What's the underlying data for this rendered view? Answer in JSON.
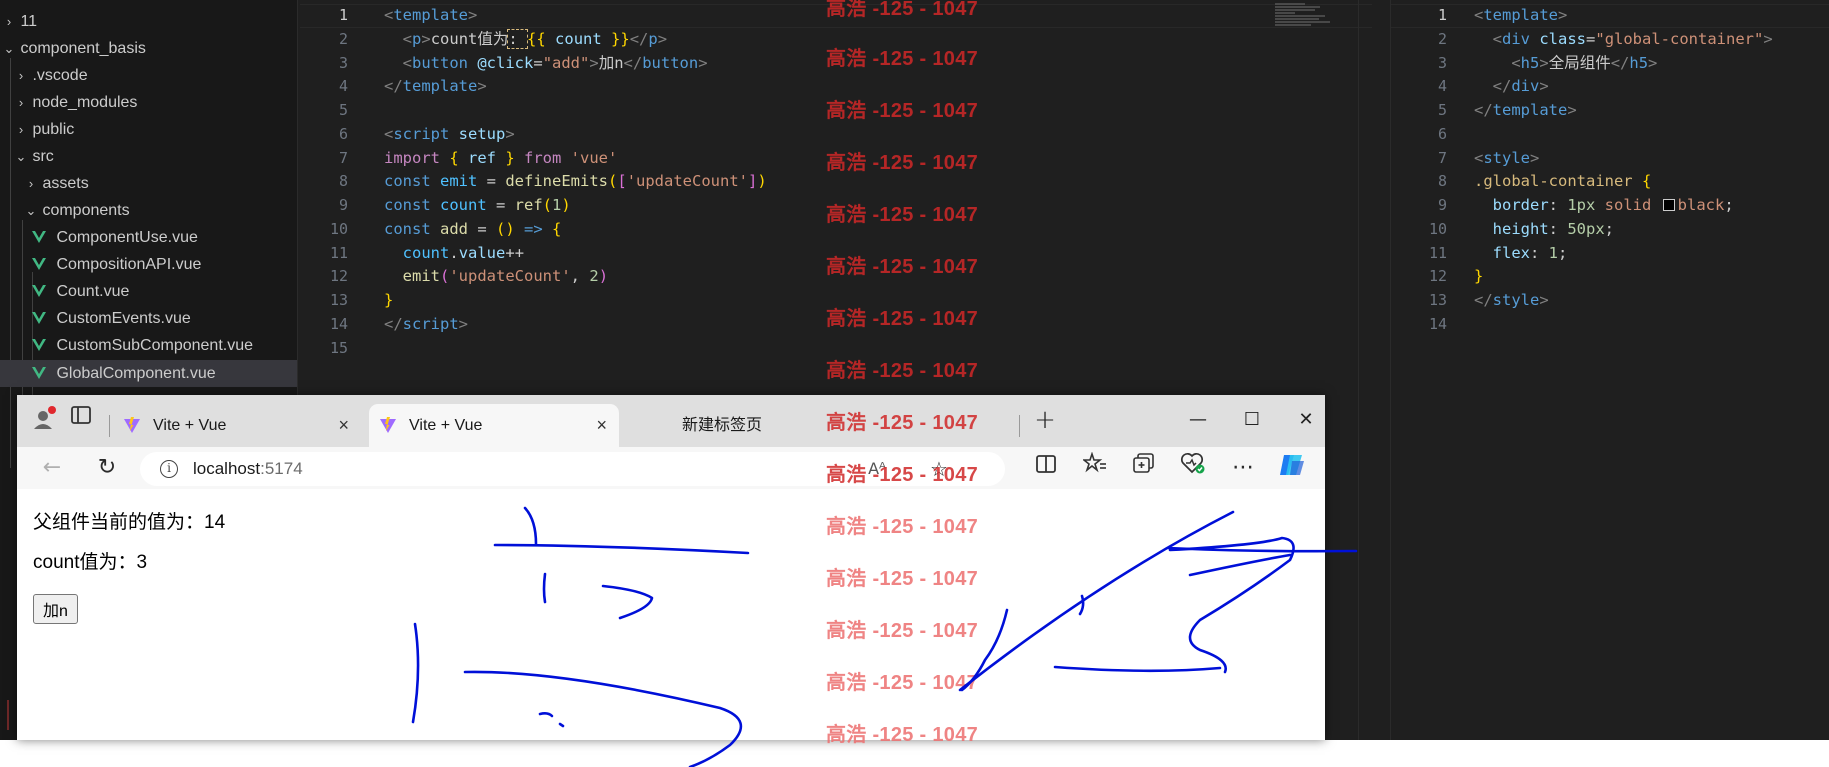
{
  "explorer": {
    "items": [
      {
        "label": "11",
        "kind": "folder-collapsed"
      },
      {
        "label": "component_basis",
        "kind": "folder-open"
      },
      {
        "label": ".vscode",
        "kind": "folder-collapsed"
      },
      {
        "label": "node_modules",
        "kind": "folder-collapsed"
      },
      {
        "label": "public",
        "kind": "folder-collapsed"
      },
      {
        "label": "src",
        "kind": "folder-open"
      },
      {
        "label": "assets",
        "kind": "folder-collapsed"
      },
      {
        "label": "components",
        "kind": "folder-open"
      },
      {
        "label": "ComponentUse.vue",
        "kind": "vue-file"
      },
      {
        "label": "CompositionAPI.vue",
        "kind": "vue-file"
      },
      {
        "label": "Count.vue",
        "kind": "vue-file"
      },
      {
        "label": "CustomEvents.vue",
        "kind": "vue-file"
      },
      {
        "label": "CustomSubComponent.vue",
        "kind": "vue-file"
      },
      {
        "label": "GlobalComponent.vue",
        "kind": "vue-file",
        "selected": true
      }
    ]
  },
  "editor_left": {
    "line_numbers": [
      "1",
      "2",
      "3",
      "4",
      "5",
      "6",
      "7",
      "8",
      "9",
      "10",
      "11",
      "12",
      "13",
      "14",
      "15"
    ],
    "active_line": "1",
    "code": {
      "l1": {
        "a": "<",
        "b": "template",
        "c": ">"
      },
      "l2": {
        "a": "<",
        "b": "p",
        "c": ">",
        "d": "count值为",
        "e": ": ",
        "f": "{{",
        "g": " count ",
        "h": "}}",
        "i": "</",
        "j": "p",
        "k": ">"
      },
      "l3": {
        "a": "<",
        "b": "button",
        "c": " @click",
        "d": "=",
        "e": "\"add\"",
        "f": ">",
        "g": "加n",
        "h": "</",
        "i": "button",
        "j": ">"
      },
      "l4": {
        "a": "</",
        "b": "template",
        "c": ">"
      },
      "l6": {
        "a": "<",
        "b": "script",
        "c": " setup",
        "d": ">"
      },
      "l7": {
        "a": "import",
        "b": " { ",
        "c": "ref",
        "d": " } ",
        "e": "from",
        "f": " 'vue'"
      },
      "l8": {
        "a": "const",
        "b": " emit",
        "c": " = ",
        "d": "defineEmits",
        "e": "(",
        "f": "[",
        "g": "'updateCount'",
        "h": "]",
        "i": ")"
      },
      "l9": {
        "a": "const",
        "b": " count",
        "c": " = ",
        "d": "ref",
        "e": "(",
        "f": "1",
        "g": ")"
      },
      "l10": {
        "a": "const",
        "b": " add",
        "c": " = ",
        "d": "()",
        "e": " => ",
        "f": "{"
      },
      "l11": {
        "a": "count",
        "b": ".",
        "c": "value",
        "d": "++"
      },
      "l12": {
        "a": "emit",
        "b": "(",
        "c": "'updateCount'",
        "d": ", ",
        "e": "2",
        "f": ")"
      },
      "l13": {
        "a": "}"
      },
      "l14": {
        "a": "</",
        "b": "script",
        "c": ">"
      }
    }
  },
  "editor_right": {
    "line_numbers": [
      "1",
      "2",
      "3",
      "4",
      "5",
      "6",
      "7",
      "8",
      "9",
      "10",
      "11",
      "12",
      "13",
      "14"
    ],
    "active_line": "1",
    "code": {
      "l1": {
        "a": "<",
        "b": "template",
        "c": ">"
      },
      "l2": {
        "a": "<",
        "b": "div",
        "c": " class",
        "d": "=",
        "e": "\"global-container\"",
        "f": ">"
      },
      "l3": {
        "a": "<",
        "b": "h5",
        "c": ">",
        "d": "全局组件",
        "e": "</",
        "f": "h5",
        "g": ">"
      },
      "l4": {
        "a": "</",
        "b": "div",
        "c": ">"
      },
      "l5": {
        "a": "</",
        "b": "template",
        "c": ">"
      },
      "l7": {
        "a": "<",
        "b": "style",
        "c": ">"
      },
      "l8": {
        "a": ".global-container",
        "b": " {"
      },
      "l9": {
        "a": "border",
        "b": ": ",
        "c": "1px",
        "d": " solid ",
        "e": "black",
        "f": ";"
      },
      "l10": {
        "a": "height",
        "b": ": ",
        "c": "50px",
        "d": ";"
      },
      "l11": {
        "a": "flex",
        "b": ": ",
        "c": "1",
        "d": ";"
      },
      "l12": {
        "a": "}"
      },
      "l13": {
        "a": "</",
        "b": "style",
        "c": ">"
      }
    }
  },
  "browser": {
    "tabs": [
      {
        "title": "Vite + Vue",
        "close": "×"
      },
      {
        "title": "Vite + Vue",
        "close": "×",
        "active": true
      },
      {
        "title": "新建标签页"
      }
    ],
    "new_tab": "+",
    "window_controls": {
      "minimize": "—",
      "maximize": "☐",
      "close": "✕"
    },
    "address": {
      "host": "localhost",
      "port": ":5174"
    },
    "page": {
      "parent_value": "父组件当前的值为：14",
      "count_line": "count值为：3",
      "add_button": "加n"
    },
    "icons": [
      "profile-icon",
      "tab-actions-icon",
      "back-icon",
      "refresh-icon",
      "info-icon",
      "read-aloud-icon",
      "favorite-icon",
      "split-screen-icon",
      "favorites-icon",
      "collections-icon",
      "browser-essentials-icon",
      "more-icon",
      "copilot-icon"
    ]
  },
  "watermark": {
    "text": "高浩 -125 - 1047",
    "color_dark": "#d02828",
    "color_light": "#ec6e6e"
  },
  "colors": {
    "editor_bg": "#1f1f1f",
    "explorer_bg": "#181818",
    "selection": "#37373d",
    "ink": "#0010d8",
    "vue_green": "#41b883"
  }
}
